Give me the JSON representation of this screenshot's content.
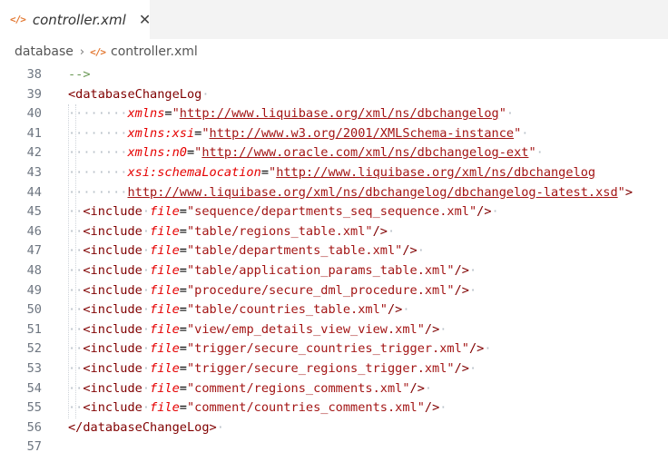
{
  "tab": {
    "icon": "xml-icon",
    "label": "controller.xml",
    "close": "✕"
  },
  "breadcrumb": {
    "root": "database",
    "separator": "›",
    "file": "controller.xml"
  },
  "lines": [
    {
      "n": "38",
      "parts": [
        [
          "comment",
          "-->"
        ]
      ]
    },
    {
      "n": "39",
      "parts": [
        [
          "tag",
          "<databaseChangeLog"
        ],
        [
          "ws",
          "·"
        ]
      ]
    },
    {
      "n": "40",
      "indent": "········",
      "parts": [
        [
          "attr",
          "xmlns"
        ],
        [
          "eq",
          "="
        ],
        [
          "str",
          "\""
        ],
        [
          "url",
          "http://www.liquibase.org/xml/ns/dbchangelog"
        ],
        [
          "str",
          "\""
        ],
        [
          "ws",
          "·"
        ]
      ]
    },
    {
      "n": "41",
      "indent": "········",
      "parts": [
        [
          "attr",
          "xmlns:xsi"
        ],
        [
          "eq",
          "="
        ],
        [
          "str",
          "\""
        ],
        [
          "url",
          "http://www.w3.org/2001/XMLSchema-instance"
        ],
        [
          "str",
          "\""
        ],
        [
          "ws",
          "·"
        ]
      ]
    },
    {
      "n": "42",
      "indent": "········",
      "parts": [
        [
          "attr",
          "xmlns:n0"
        ],
        [
          "eq",
          "="
        ],
        [
          "str",
          "\""
        ],
        [
          "url",
          "http://www.oracle.com/xml/ns/dbchangelog-ext"
        ],
        [
          "str",
          "\""
        ],
        [
          "ws",
          "·"
        ]
      ]
    },
    {
      "n": "43",
      "indent": "········",
      "parts": [
        [
          "attr",
          "xsi:schemaLocation"
        ],
        [
          "eq",
          "="
        ],
        [
          "str",
          "\""
        ],
        [
          "url",
          "http://www.liquibase.org/xml/ns/dbchangelog"
        ]
      ]
    },
    {
      "n": "44",
      "indent": "········",
      "parts": [
        [
          "url",
          "http://www.liquibase.org/xml/ns/dbchangelog/dbchangelog-latest.xsd"
        ],
        [
          "str",
          "\""
        ],
        [
          "tag",
          ">"
        ]
      ]
    },
    {
      "n": "45",
      "indent": "··",
      "parts": [
        [
          "tag",
          "<include"
        ],
        [
          "ws",
          "·"
        ],
        [
          "attr",
          "file"
        ],
        [
          "eq",
          "="
        ],
        [
          "str",
          "\"sequence/departments_seq_sequence.xml\""
        ],
        [
          "tag",
          "/>"
        ],
        [
          "ws",
          "·"
        ]
      ]
    },
    {
      "n": "46",
      "indent": "··",
      "parts": [
        [
          "tag",
          "<include"
        ],
        [
          "ws",
          "·"
        ],
        [
          "attr",
          "file"
        ],
        [
          "eq",
          "="
        ],
        [
          "str",
          "\"table/regions_table.xml\""
        ],
        [
          "tag",
          "/>"
        ],
        [
          "ws",
          "·"
        ]
      ]
    },
    {
      "n": "47",
      "indent": "··",
      "parts": [
        [
          "tag",
          "<include"
        ],
        [
          "ws",
          "·"
        ],
        [
          "attr",
          "file"
        ],
        [
          "eq",
          "="
        ],
        [
          "str",
          "\"table/departments_table.xml\""
        ],
        [
          "tag",
          "/>"
        ],
        [
          "ws",
          "·"
        ]
      ]
    },
    {
      "n": "48",
      "indent": "··",
      "parts": [
        [
          "tag",
          "<include"
        ],
        [
          "ws",
          "·"
        ],
        [
          "attr",
          "file"
        ],
        [
          "eq",
          "="
        ],
        [
          "str",
          "\"table/application_params_table.xml\""
        ],
        [
          "tag",
          "/>"
        ],
        [
          "ws",
          "·"
        ]
      ]
    },
    {
      "n": "49",
      "indent": "··",
      "parts": [
        [
          "tag",
          "<include"
        ],
        [
          "ws",
          "·"
        ],
        [
          "attr",
          "file"
        ],
        [
          "eq",
          "="
        ],
        [
          "str",
          "\"procedure/secure_dml_procedure.xml\""
        ],
        [
          "tag",
          "/>"
        ],
        [
          "ws",
          "·"
        ]
      ]
    },
    {
      "n": "50",
      "indent": "··",
      "parts": [
        [
          "tag",
          "<include"
        ],
        [
          "ws",
          "·"
        ],
        [
          "attr",
          "file"
        ],
        [
          "eq",
          "="
        ],
        [
          "str",
          "\"table/countries_table.xml\""
        ],
        [
          "tag",
          "/>"
        ],
        [
          "ws",
          "·"
        ]
      ]
    },
    {
      "n": "51",
      "indent": "··",
      "parts": [
        [
          "tag",
          "<include"
        ],
        [
          "ws",
          "·"
        ],
        [
          "attr",
          "file"
        ],
        [
          "eq",
          "="
        ],
        [
          "str",
          "\"view/emp_details_view_view.xml\""
        ],
        [
          "tag",
          "/>"
        ],
        [
          "ws",
          "·"
        ]
      ]
    },
    {
      "n": "52",
      "indent": "··",
      "parts": [
        [
          "tag",
          "<include"
        ],
        [
          "ws",
          "·"
        ],
        [
          "attr",
          "file"
        ],
        [
          "eq",
          "="
        ],
        [
          "str",
          "\"trigger/secure_countries_trigger.xml\""
        ],
        [
          "tag",
          "/>"
        ],
        [
          "ws",
          "·"
        ]
      ]
    },
    {
      "n": "53",
      "indent": "··",
      "parts": [
        [
          "tag",
          "<include"
        ],
        [
          "ws",
          "·"
        ],
        [
          "attr",
          "file"
        ],
        [
          "eq",
          "="
        ],
        [
          "str",
          "\"trigger/secure_regions_trigger.xml\""
        ],
        [
          "tag",
          "/>"
        ],
        [
          "ws",
          "·"
        ]
      ]
    },
    {
      "n": "54",
      "indent": "··",
      "parts": [
        [
          "tag",
          "<include"
        ],
        [
          "ws",
          "·"
        ],
        [
          "attr",
          "file"
        ],
        [
          "eq",
          "="
        ],
        [
          "str",
          "\"comment/regions_comments.xml\""
        ],
        [
          "tag",
          "/>"
        ],
        [
          "ws",
          "·"
        ]
      ]
    },
    {
      "n": "55",
      "indent": "··",
      "parts": [
        [
          "tag",
          "<include"
        ],
        [
          "ws",
          "·"
        ],
        [
          "attr",
          "file"
        ],
        [
          "eq",
          "="
        ],
        [
          "str",
          "\"comment/countries_comments.xml\""
        ],
        [
          "tag",
          "/>"
        ],
        [
          "ws",
          "·"
        ]
      ]
    },
    {
      "n": "56",
      "parts": [
        [
          "tag",
          "</databaseChangeLog>"
        ],
        [
          "ws",
          "·"
        ]
      ]
    },
    {
      "n": "57",
      "parts": []
    }
  ],
  "colors": {
    "icon": "#e37933",
    "tag": "#800000",
    "attr": "#e50000",
    "string": "#a31515"
  }
}
